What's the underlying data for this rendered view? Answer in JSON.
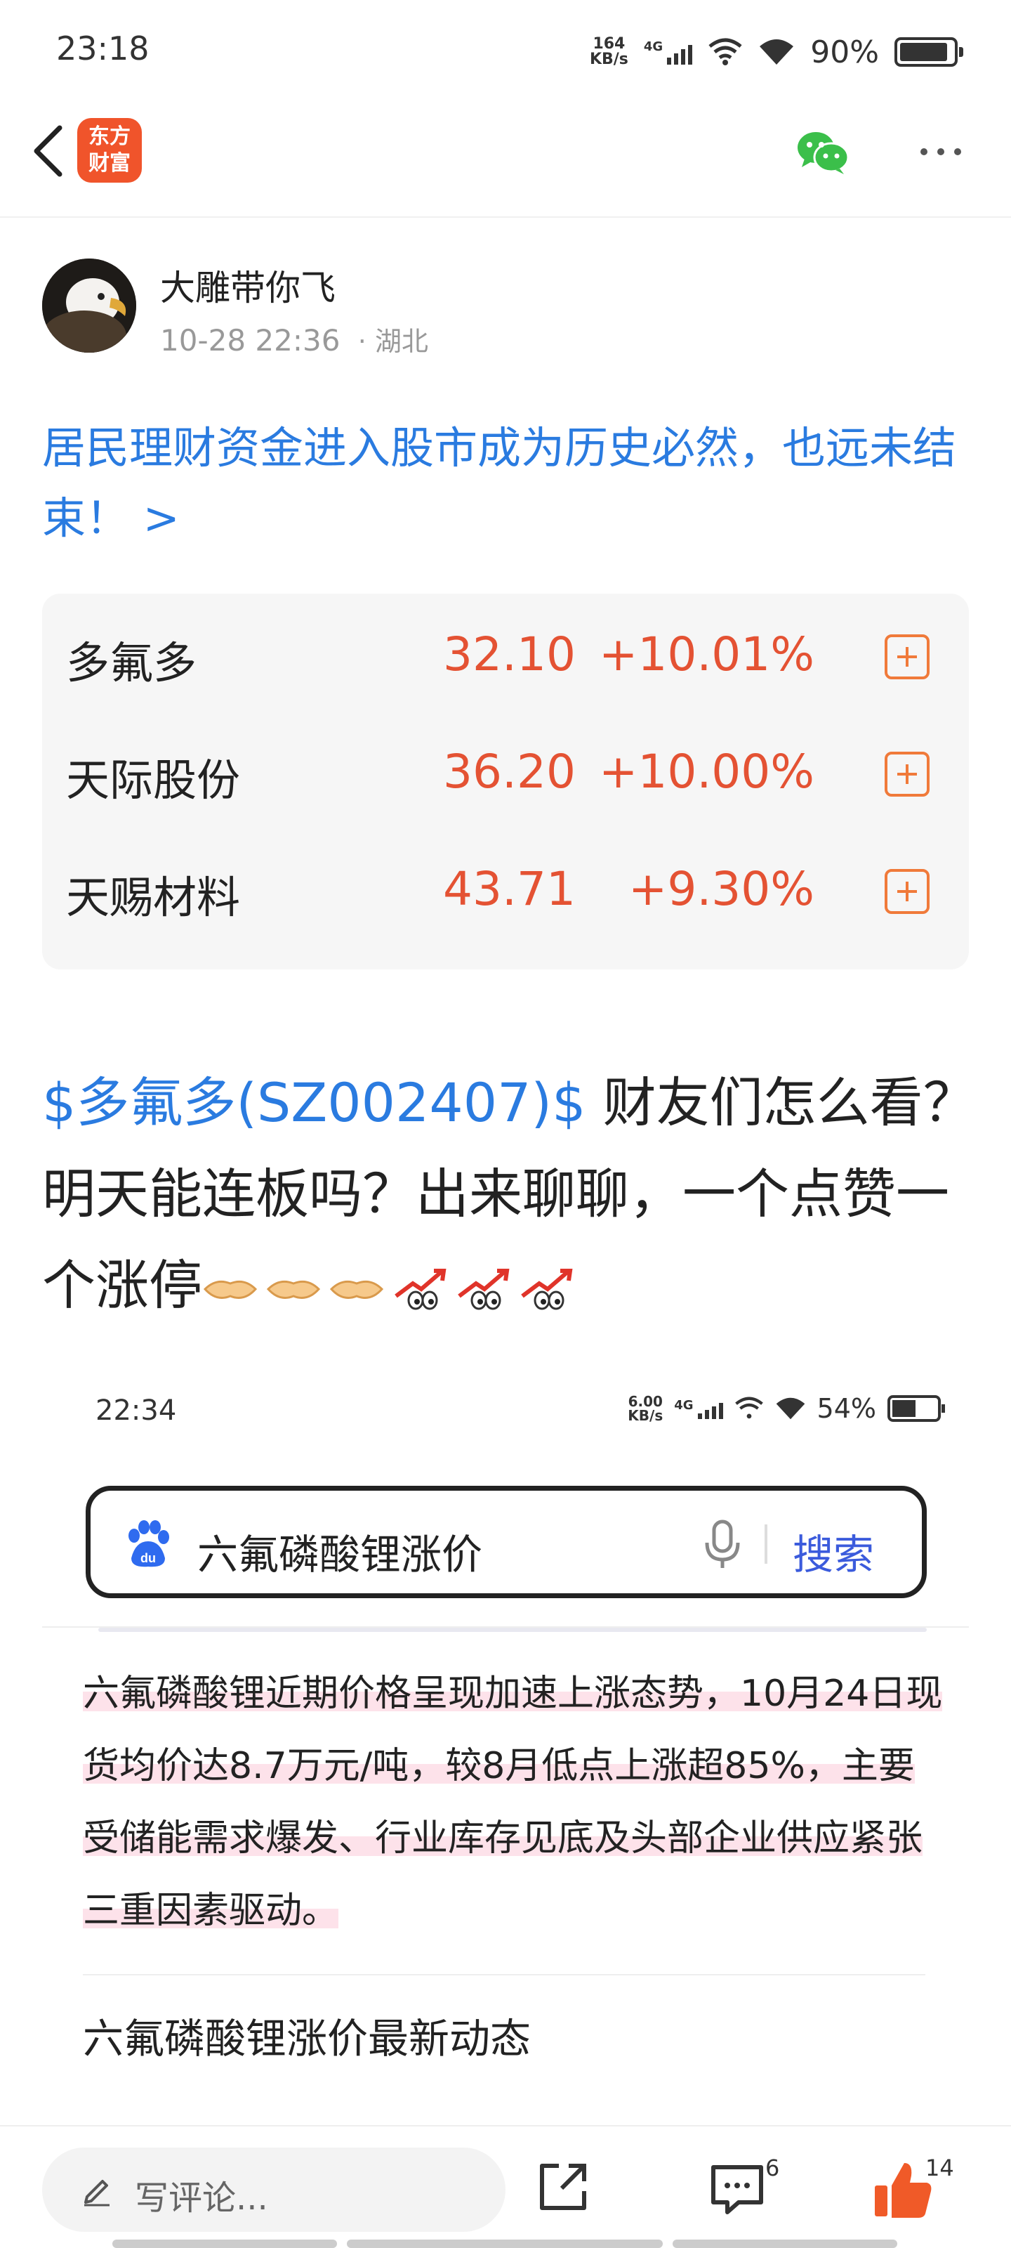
{
  "status_bar": {
    "time": "23:18",
    "net_speed_value": "164",
    "net_speed_unit": "KB/s",
    "signal_label": "4G",
    "battery": "90%",
    "battery_level": 0.9
  },
  "nav": {
    "logo_line1": "东方",
    "logo_line2": "财富",
    "brand_color": "#f0542b"
  },
  "post": {
    "author": "大雕带你飞",
    "date": "10-28 22:36",
    "location": "· 湖北",
    "title": "居民理财资金进入股市成为历史必然，也远未结束！ >",
    "body_stock_tag": "$多氟多(SZ002407)$",
    "body_text": " 财友们怎么看？明天能连板吗？出来聊聊，一个点赞一个涨停"
  },
  "stocks": [
    {
      "name": "多氟多",
      "price": "32.10",
      "change": "+10.01%"
    },
    {
      "name": "天际股份",
      "price": "36.20",
      "change": "+10.00%"
    },
    {
      "name": "天赐材料",
      "price": "43.71",
      "change": "+9.30%"
    }
  ],
  "embedded": {
    "time": "22:34",
    "net_speed_value": "6.00",
    "net_speed_unit": "KB/s",
    "signal_label": "4G",
    "battery": "54%",
    "battery_level": 0.54,
    "search_query": "六氟磷酸锂涨价",
    "search_button": "搜索",
    "paragraph": "六氟磷酸锂近期价格呈现加速上涨态势，10月24日现货均价达8.7万元/吨，较8月低点上涨超85%，主要受储能需求爆发、行业库存见底及头部企业供应紧张三重因素驱动。",
    "heading": "六氟磷酸锂涨价最新动态"
  },
  "bottom_bar": {
    "comment_placeholder": "写评论...",
    "comment_count": "6",
    "like_count": "14"
  },
  "colors": {
    "link_blue": "#2a7be0",
    "stock_red": "#e45233",
    "add_orange": "#f07a3a"
  }
}
